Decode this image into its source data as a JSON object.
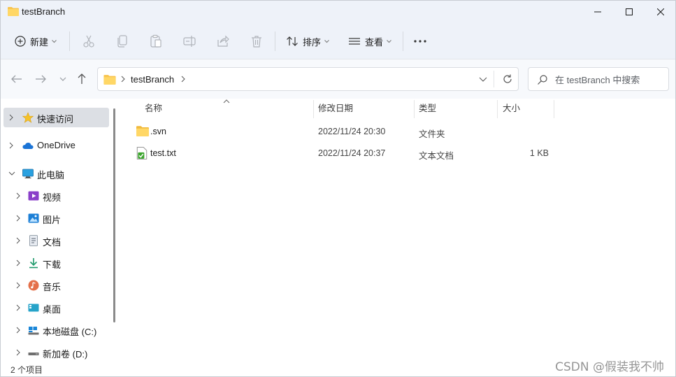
{
  "window": {
    "title": "testBranch"
  },
  "toolbar": {
    "new_label": "新建",
    "sort_label": "排序",
    "view_label": "查看",
    "more_label": "···"
  },
  "address": {
    "crumb": "testBranch"
  },
  "search": {
    "placeholder": "在 testBranch 中搜索"
  },
  "sidebar": {
    "items": [
      {
        "label": "快速访问",
        "icon": "star-icon"
      },
      {
        "label": "OneDrive",
        "icon": "cloud-icon"
      },
      {
        "label": "此电脑",
        "icon": "computer-icon"
      },
      {
        "label": "视频",
        "icon": "video-icon"
      },
      {
        "label": "图片",
        "icon": "picture-icon"
      },
      {
        "label": "文档",
        "icon": "document-icon"
      },
      {
        "label": "下载",
        "icon": "download-icon"
      },
      {
        "label": "音乐",
        "icon": "music-icon"
      },
      {
        "label": "桌面",
        "icon": "desktop-icon"
      },
      {
        "label": "本地磁盘 (C:)",
        "icon": "drive-icon"
      },
      {
        "label": "新加卷 (D:)",
        "icon": "drive-icon"
      }
    ]
  },
  "columns": {
    "name": "名称",
    "date": "修改日期",
    "type": "类型",
    "size": "大小"
  },
  "files": [
    {
      "name": ".svn",
      "date": "2022/11/24 20:30",
      "type": "文件夹",
      "size": "",
      "icon": "folder-icon"
    },
    {
      "name": "test.txt",
      "date": "2022/11/24 20:37",
      "type": "文本文档",
      "size": "1 KB",
      "icon": "text-file-icon"
    }
  ],
  "status": {
    "count": "2 个项目"
  },
  "watermark": "CSDN @假装我不帅",
  "colors": {
    "folder": "#f8c44f",
    "accent": "#0067c0",
    "selected": "#dcdfe4"
  }
}
